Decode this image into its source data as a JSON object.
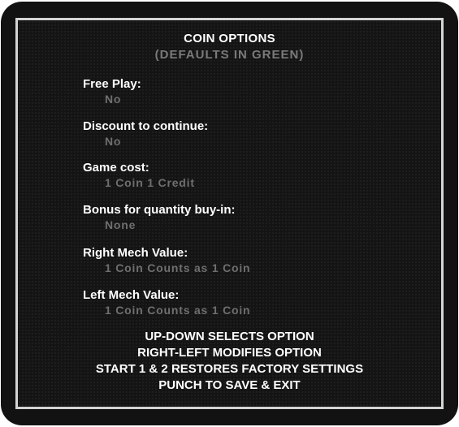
{
  "screen": {
    "title": "COIN OPTIONS",
    "subtitle": "(DEFAULTS IN GREEN)"
  },
  "options": [
    {
      "label": "Free Play:",
      "value": "No"
    },
    {
      "label": "Discount to continue:",
      "value": "No"
    },
    {
      "label": "Game cost:",
      "value": "1 Coin 1 Credit"
    },
    {
      "label": "Bonus for quantity buy-in:",
      "value": "None"
    },
    {
      "label": "Right Mech Value:",
      "value": "1 Coin Counts as 1 Coin"
    },
    {
      "label": "Left Mech Value:",
      "value": "1 Coin Counts as 1 Coin"
    }
  ],
  "instructions": [
    "UP-DOWN SELECTS OPTION",
    "RIGHT-LEFT MODIFIES OPTION",
    "START 1 & 2 RESTORES FACTORY SETTINGS",
    "PUNCH TO SAVE & EXIT"
  ],
  "colors": {
    "background": "#121212",
    "border": "#d4d4d4",
    "label_text": "#ffffff",
    "default_value_text": "#6f6f6f"
  }
}
